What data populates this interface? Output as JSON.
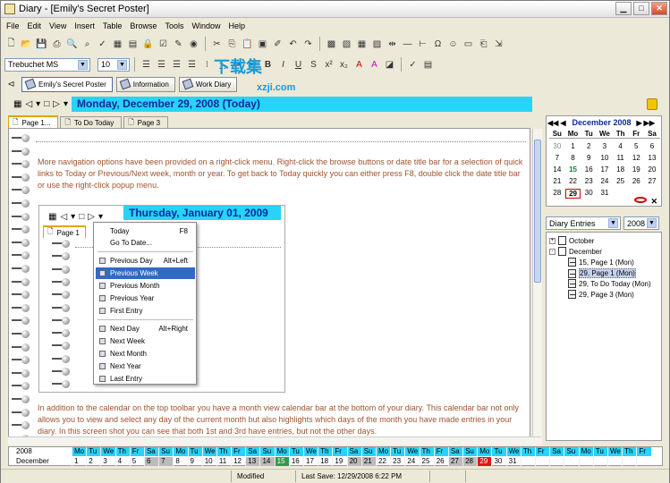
{
  "window": {
    "title": "Diary - [Emily's Secret Poster]"
  },
  "menu": [
    "File",
    "Edit",
    "View",
    "Insert",
    "Table",
    "Browse",
    "Tools",
    "Window",
    "Help"
  ],
  "format": {
    "font": "Trebuchet MS",
    "size": "10"
  },
  "quicklinks": [
    {
      "label": "Emily's Secret Poster"
    },
    {
      "label": "Information"
    },
    {
      "label": "Work Diary"
    }
  ],
  "datebar": {
    "title": "Monday, December 29, 2008 (Today)"
  },
  "page_tabs": [
    "Page 1...",
    "To Do Today",
    "Page 3"
  ],
  "content": {
    "para1": "More navigation options have been provided on a right-click menu. Right-click the browse buttons or date title bar for a selection of quick links to Today or Previous/Next week, month or year. To get back to Today quickly you can either press F8, double click the date title bar or use the right-click popup menu.",
    "para2": "In addition to the calendar on the top toolbar you have a month view calendar bar at the bottom of your diary. This calendar bar not only allows you to view and select any day of the current month but also highlights which days of the month you have made entries in your diary. In this screen shot you can see that both 1st and 3rd have entries, but not the other days."
  },
  "inner": {
    "title": "Thursday, January 01, 2009",
    "tab": "Page 1"
  },
  "context_menu": [
    {
      "label": "Today",
      "shortcut": "F8"
    },
    {
      "label": "Go To Date..."
    },
    {
      "label": "Previous Day",
      "shortcut": "Alt+Left"
    },
    {
      "label": "Previous Week",
      "highlighted": true
    },
    {
      "label": "Previous Month"
    },
    {
      "label": "Previous Year"
    },
    {
      "label": "First Entry"
    },
    {
      "label": "Next Day",
      "shortcut": "Alt+Right"
    },
    {
      "label": "Next Week"
    },
    {
      "label": "Next Month"
    },
    {
      "label": "Next Year"
    },
    {
      "label": "Last Entry"
    }
  ],
  "calendar": {
    "month": "December 2008",
    "dow": [
      "Su",
      "Mo",
      "Tu",
      "We",
      "Th",
      "Fr",
      "Sa"
    ],
    "weeks": [
      [
        "30",
        "1",
        "2",
        "3",
        "4",
        "5",
        "6"
      ],
      [
        "7",
        "8",
        "9",
        "10",
        "11",
        "12",
        "13"
      ],
      [
        "14",
        "15",
        "16",
        "17",
        "18",
        "19",
        "20"
      ],
      [
        "21",
        "22",
        "23",
        "24",
        "25",
        "26",
        "27"
      ],
      [
        "28",
        "29",
        "30",
        "31",
        "",
        "",
        ""
      ]
    ]
  },
  "tree": {
    "view": "Diary Entries",
    "year": "2008",
    "nodes": [
      {
        "label": "October",
        "level": 0,
        "expander": "+"
      },
      {
        "label": "December",
        "level": 0,
        "expander": "-"
      },
      {
        "label": "15, Page 1 (Mon)",
        "level": 1
      },
      {
        "label": "29, Page 1 (Mon)",
        "level": 1,
        "selected": true
      },
      {
        "label": "29, To Do Today (Mon)",
        "level": 1
      },
      {
        "label": "29, Page 3 (Mon)",
        "level": 1
      }
    ]
  },
  "monthbar": {
    "year": "2008",
    "month": "December",
    "dow": [
      "Mo",
      "Tu",
      "We",
      "Th",
      "Fr",
      "Sa",
      "Su",
      "Mo",
      "Tu",
      "We",
      "Th",
      "Fr",
      "Sa",
      "Su",
      "Mo",
      "Tu",
      "We",
      "Th",
      "Fr",
      "Sa",
      "Su",
      "Mo",
      "Tu",
      "We",
      "Th",
      "Fr",
      "Sa",
      "Su",
      "Mo",
      "Tu",
      "We",
      "Th",
      "Fr",
      "Sa",
      "Su",
      "Mo",
      "Tu",
      "We",
      "Th",
      "Fr"
    ],
    "days": [
      "1",
      "2",
      "3",
      "4",
      "5",
      "6",
      "7",
      "8",
      "9",
      "10",
      "11",
      "12",
      "13",
      "14",
      "15",
      "16",
      "17",
      "18",
      "19",
      "20",
      "21",
      "22",
      "23",
      "24",
      "25",
      "26",
      "27",
      "28",
      "29",
      "30",
      "31"
    ]
  },
  "status": {
    "modified": "Modified",
    "last_save": "Last Save: 12/29/2008 6:22 PM"
  },
  "watermark": {
    "brand": "下载集",
    "url": "xzji.com"
  },
  "colors": {
    "date_bar": "#27d3f7",
    "text_brown": "#a0522d",
    "highlight": "#316ac5"
  }
}
